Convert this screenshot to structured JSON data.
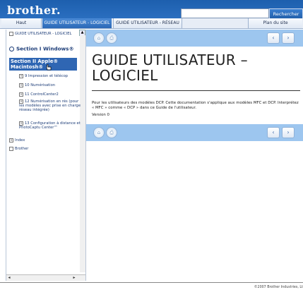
{
  "header": {
    "logo": "brother.",
    "search_placeholder": "",
    "search_button": "Rechercher"
  },
  "tabs": {
    "home": "Haut",
    "logiciel": "GUIDE UTILISATEUR - LOGICIEL",
    "reseau": "GUIDE UTILISATEUR - RÉSEAU",
    "sitemap": "Plan du site"
  },
  "sidebar": {
    "guide": "GUIDE UTILISATEUR - LOGICIEL",
    "section1": "Section I Windows®",
    "section2": "Section II Apple® Macintosh®",
    "item9": "9 Impression et télécop",
    "item10": "10 Numérisation",
    "item11": "11 ControlCenter2",
    "item12": "12 Numérisation en rés (pour les modèles avec prise en charge réseau intégrée)",
    "item13": "13 Configuration à distance et PhotoCaptu Center™",
    "index": "Index",
    "brother": "Brother"
  },
  "main": {
    "title": "GUIDE UTILISATEUR – LOGICIEL",
    "description": "Pour les utilisateurs des modèles DCP. Cette documentation s'applique aux modèles MFC et DCP. Interprétez « MFC » comme « DCP » dans ce Guide de l'utilisateur.",
    "version": "Version 0"
  },
  "footer": {
    "copyright": "©2007 Brother Industries, Lt"
  },
  "colors": {
    "header_blue": "#2f74c6",
    "navbar_blue": "#9dc6ef",
    "selected": "#2f66b3"
  }
}
